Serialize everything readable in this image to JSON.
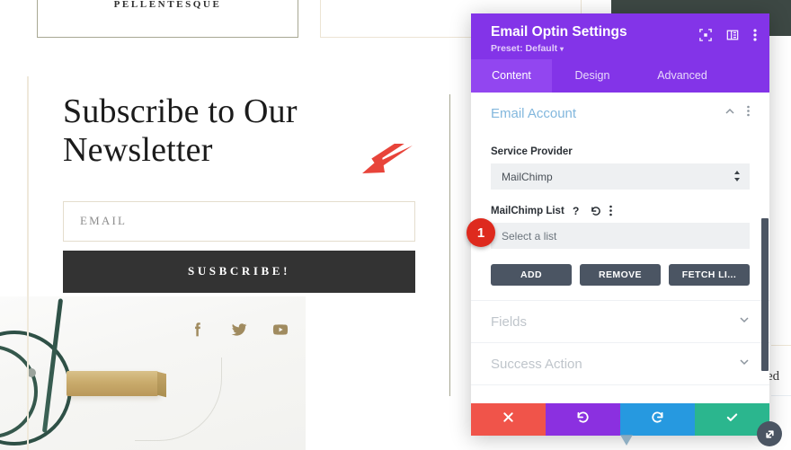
{
  "website": {
    "top_cards": [
      {
        "label": "PELLENTESQUE"
      },
      {
        "label": ""
      }
    ],
    "newsletter": {
      "title": "Subscribe to Our Newsletter",
      "email_placeholder": "EMAIL",
      "submit_label": "SUSBCRIBE!"
    },
    "socials": [
      {
        "name": "facebook-icon",
        "label": "Facebook"
      },
      {
        "name": "twitter-icon",
        "label": "Twitter"
      },
      {
        "name": "youtube-icon",
        "label": "YouTube"
      }
    ],
    "clipped_text": "ed",
    "colors": {
      "social": "#a08b5f",
      "button": "#333333",
      "rule_cream": "#efe9db",
      "rule_olive": "#a8a893",
      "dark_band": "#3d4844"
    }
  },
  "annotation": {
    "arrow_color": "#e8443a",
    "step_badge": "1"
  },
  "modal": {
    "title": "Email Optin Settings",
    "preset_label": "Preset: Default",
    "preset_caret": "▾",
    "header_icons": [
      {
        "name": "fullscreen-icon"
      },
      {
        "name": "layout-columns-icon"
      },
      {
        "name": "more-vertical-icon"
      }
    ],
    "tabs": [
      {
        "label": "Content",
        "active": true
      },
      {
        "label": "Design",
        "active": false
      },
      {
        "label": "Advanced",
        "active": false
      }
    ],
    "sections": [
      {
        "title": "Email Account",
        "state": "open",
        "toggle_icon": "chevron-up-icon",
        "menu_icon": "more-vertical-icon"
      },
      {
        "title": "Fields",
        "state": "closed",
        "toggle_icon": "chevron-down-icon"
      },
      {
        "title": "Success Action",
        "state": "closed",
        "toggle_icon": "chevron-down-icon"
      }
    ],
    "email_account": {
      "service_provider_label": "Service Provider",
      "service_provider_value": "MailChimp",
      "list_label": "MailChimp List",
      "list_icons": [
        {
          "name": "help-icon",
          "glyph": "?"
        },
        {
          "name": "reset-icon",
          "glyph": "↺"
        },
        {
          "name": "more-vertical-icon",
          "glyph": "⋮"
        }
      ],
      "list_placeholder": "Select a list",
      "buttons": [
        {
          "label": "ADD",
          "name": "add-button"
        },
        {
          "label": "REMOVE",
          "name": "remove-button"
        },
        {
          "label": "FETCH LI...",
          "name": "fetch-lists-button"
        }
      ]
    },
    "footer_actions": [
      {
        "name": "cancel-button",
        "icon": "close-icon",
        "color": "#f0544a"
      },
      {
        "name": "undo-button",
        "icon": "undo-icon",
        "color": "#8b30e0"
      },
      {
        "name": "redo-button",
        "icon": "redo-icon",
        "color": "#2699e0"
      },
      {
        "name": "save-button",
        "icon": "check-icon",
        "color": "#2bb68e"
      }
    ],
    "resize_handle_icon": "resize-diagonal-icon",
    "colors": {
      "header": "#8334e8",
      "tab_active": "#9246f0",
      "section_title": "#82b7dd",
      "section_title_closed": "#bfc5cb",
      "button": "#4b5563",
      "field_bg": "#eef0f2"
    }
  }
}
